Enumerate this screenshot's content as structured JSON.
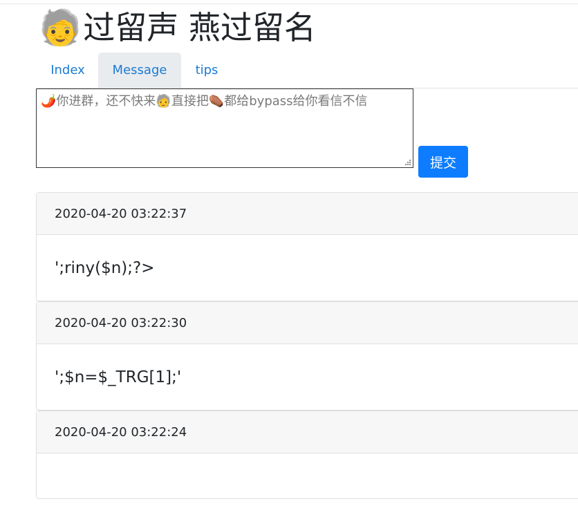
{
  "header": {
    "emoji": "🧓",
    "title": "过留声 燕过留名"
  },
  "nav": {
    "tabs": [
      {
        "label": "Index",
        "active": false
      },
      {
        "label": "Message",
        "active": true
      },
      {
        "label": "tips",
        "active": false
      }
    ]
  },
  "form": {
    "message_value": "🌶️你进群，还不快来🧓直接把⚰️都给bypass给你看信不信",
    "submit_label": "提交"
  },
  "messages": [
    {
      "time": "2020-04-20 03:22:37",
      "content": "';riny($n);?>"
    },
    {
      "time": "2020-04-20 03:22:30",
      "content": "';$n=$_TRG[1];'"
    },
    {
      "time": "2020-04-20 03:22:24",
      "content": ""
    }
  ],
  "colors": {
    "link": "#1a7bd4",
    "primary_button": "#0d7cff",
    "active_tab_bg": "#e9ecef",
    "card_header_bg": "#f7f7f7"
  }
}
